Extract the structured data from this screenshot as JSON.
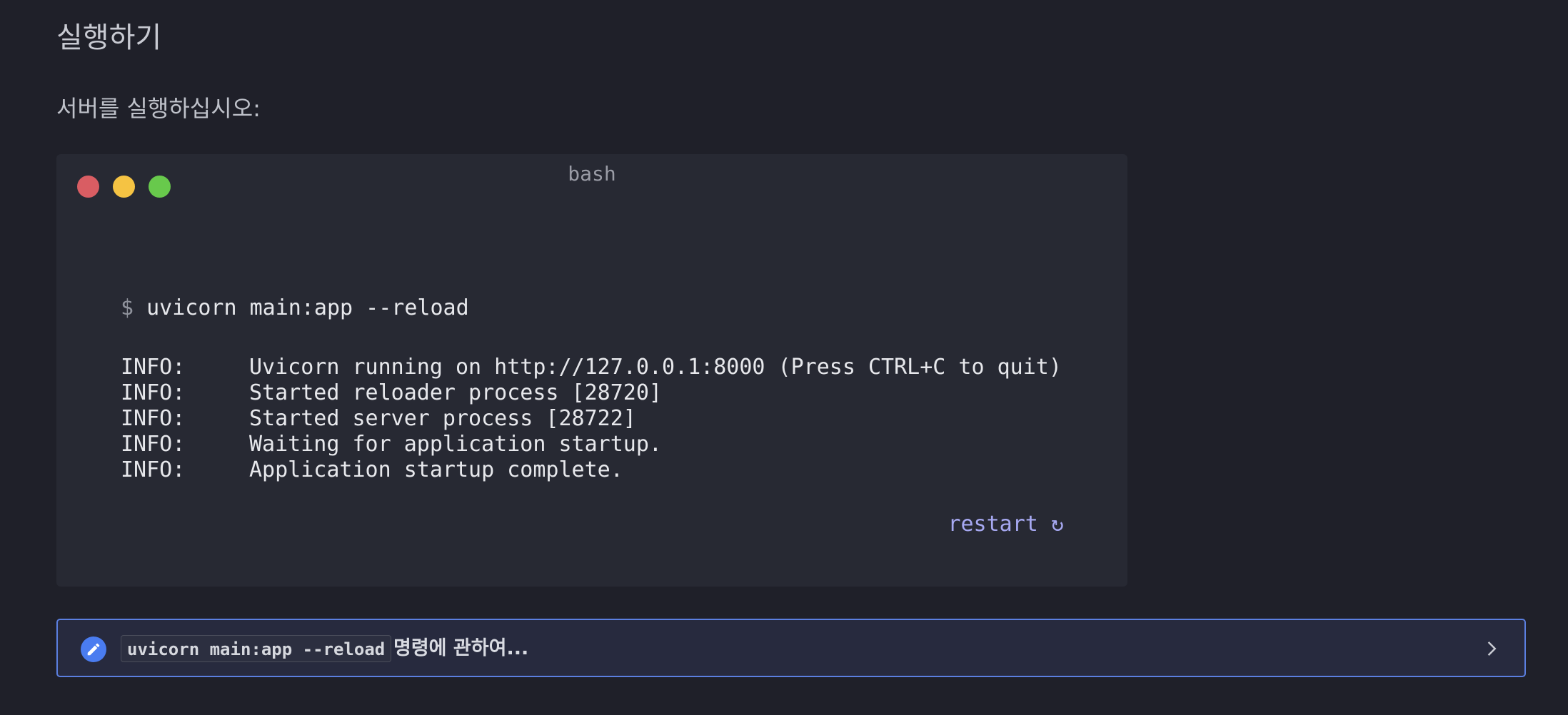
{
  "section": {
    "heading": "실행하기",
    "intro": "서버를 실행하십시오:"
  },
  "terminal": {
    "title": "bash",
    "prompt_symbol": "$",
    "command": "uvicorn main:app --reload",
    "log": [
      {
        "level": "INFO:",
        "message": "Uvicorn running on http://127.0.0.1:8000 (Press CTRL+C to quit)"
      },
      {
        "level": "INFO:",
        "message": "Started reloader process [28720]"
      },
      {
        "level": "INFO:",
        "message": "Started server process [28722]"
      },
      {
        "level": "INFO:",
        "message": "Waiting for application startup."
      },
      {
        "level": "INFO:",
        "message": "Application startup complete."
      }
    ],
    "restart_label": "restart ↻",
    "colors": {
      "close": "#d95d63",
      "minimize": "#f5c343",
      "maximize": "#68c94c"
    }
  },
  "note": {
    "icon": "pencil-icon",
    "code": "uvicorn main:app --reload",
    "text": "명령에 관하여...",
    "expand_icon": "chevron-right-icon",
    "accent": "#5b7fe0"
  }
}
